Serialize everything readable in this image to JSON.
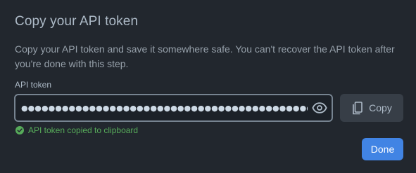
{
  "dialog": {
    "title": "Copy your API token",
    "description": "Copy your API token and save it somewhere safe. You can't recover the API token after you're done with this step.",
    "field_label": "API token",
    "token_masked": "●●●●●●●●●●●●●●●●●●●●●●●●●●●●●●●●●●●●●●●●●●●●●●●●●",
    "copy_label": "Copy",
    "status_text": "API token copied to clipboard",
    "done_label": "Done"
  },
  "icons": {
    "reveal": "eye-icon",
    "copy": "copy-icon",
    "status": "check-circle-icon"
  },
  "colors": {
    "background": "#22272e",
    "accent": "#4184e4",
    "success": "#57ab5a"
  }
}
